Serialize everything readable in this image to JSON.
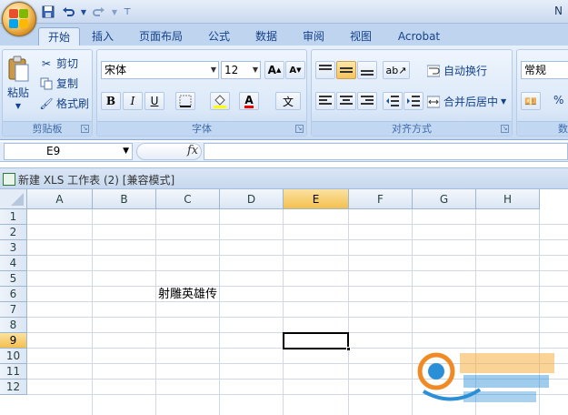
{
  "window": {
    "title_fragment": "N"
  },
  "quick_access": [
    "save-icon",
    "undo-icon",
    "redo-icon"
  ],
  "tabs": [
    {
      "label": "开始",
      "active": true
    },
    {
      "label": "插入"
    },
    {
      "label": "页面布局"
    },
    {
      "label": "公式"
    },
    {
      "label": "数据"
    },
    {
      "label": "审阅"
    },
    {
      "label": "视图"
    },
    {
      "label": "Acrobat"
    }
  ],
  "clipboard": {
    "paste": "粘贴",
    "cut": "剪切",
    "copy": "复制",
    "format_painter": "格式刷",
    "group": "剪贴板"
  },
  "font": {
    "name": "宋体",
    "size": "12",
    "bold": "B",
    "italic": "I",
    "underline": "U",
    "color_letter": "A",
    "phonetic": "文",
    "group": "字体"
  },
  "alignment": {
    "wrap": "自动换行",
    "merge": "合并后居中",
    "group": "对齐方式"
  },
  "number": {
    "format": "常规",
    "percent": "%",
    "group_fragment": "数"
  },
  "formula_bar": {
    "cell_ref": "E9",
    "fx": "fx",
    "value": ""
  },
  "workbook": {
    "title": "新建 XLS 工作表 (2)  [兼容模式]"
  },
  "sheet": {
    "columns": [
      "A",
      "B",
      "C",
      "D",
      "E",
      "F",
      "G",
      "H"
    ],
    "rows": [
      "1",
      "2",
      "3",
      "4",
      "5",
      "6",
      "7",
      "8",
      "9",
      "10",
      "11",
      "12"
    ],
    "selected_column": "E",
    "selected_row": "9",
    "cells": {
      "C6": "射雕英雄传"
    }
  },
  "colors": {
    "accent": "#f3c04f",
    "ribbon": "#dbe8f8",
    "text": "#15428b"
  }
}
